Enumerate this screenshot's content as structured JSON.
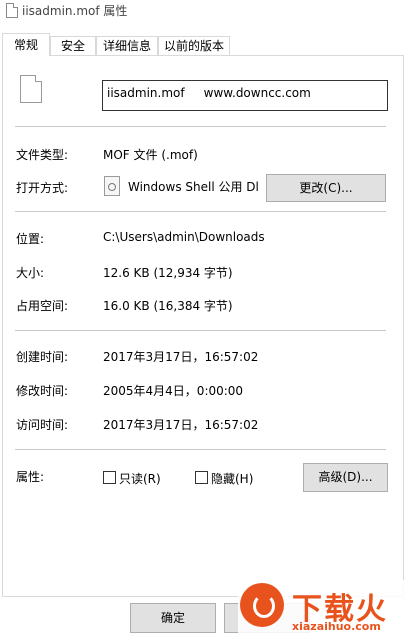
{
  "window": {
    "title": "iisadmin.mof 属性"
  },
  "tabs": [
    {
      "label": "常规",
      "active": true
    },
    {
      "label": "安全"
    },
    {
      "label": "详细信息"
    },
    {
      "label": "以前的版本"
    }
  ],
  "general": {
    "file_name": "iisadmin.mof     www.downcc.com",
    "file_type_label": "文件类型:",
    "file_type_value": "MOF 文件 (.mof)",
    "open_with_label": "打开方式:",
    "open_with_value": "Windows Shell 公用 Dl",
    "change_button": "更改(C)...",
    "location_label": "位置:",
    "location_value": "C:\\Users\\admin\\Downloads",
    "size_label": "大小:",
    "size_value": "12.6 KB (12,934 字节)",
    "disk_size_label": "占用空间:",
    "disk_size_value": "16.0 KB (16,384 字节)",
    "created_label": "创建时间:",
    "created_value": "2017年3月17日，16:57:02",
    "modified_label": "修改时间:",
    "modified_value": "2005年4月4日，0:00:00",
    "accessed_label": "访问时间:",
    "accessed_value": "2017年3月17日，16:57:02",
    "attributes_label": "属性:",
    "readonly_label": "只读(R)",
    "readonly_checked": false,
    "hidden_label": "隐藏(H)",
    "hidden_checked": false,
    "advanced_button": "高级(D)..."
  },
  "footer": {
    "ok_button": "确定"
  },
  "watermark": {
    "brand": "下载火",
    "url": "xiazaihuo.com",
    "color": "#e8531d"
  }
}
